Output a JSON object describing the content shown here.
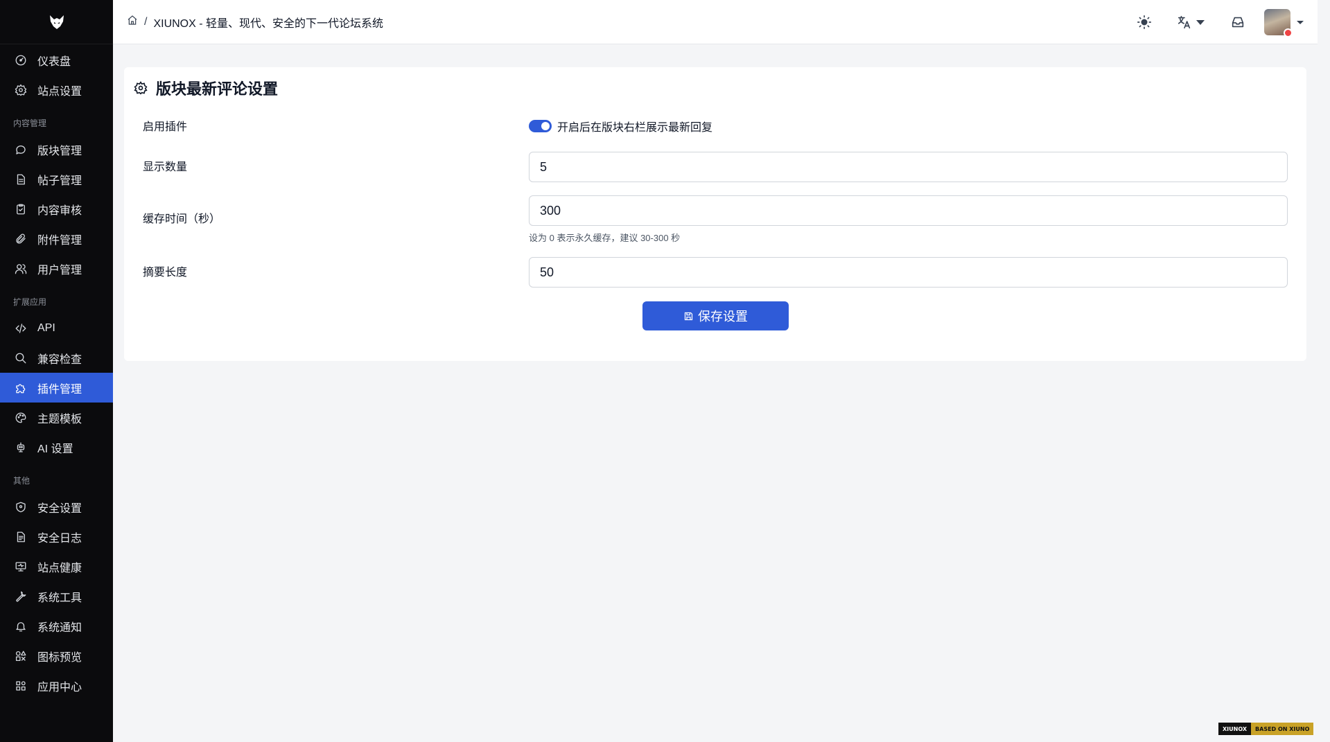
{
  "sidebar": {
    "logo_icon": "wolf-head-logo",
    "items_top": [
      {
        "label": "仪表盘",
        "icon": "dashboard-icon"
      },
      {
        "label": "站点设置",
        "icon": "gear-icon"
      }
    ],
    "section_content": "内容管理",
    "items_content": [
      {
        "label": "版块管理",
        "icon": "chat-bubble-icon"
      },
      {
        "label": "帖子管理",
        "icon": "document-icon"
      },
      {
        "label": "内容审核",
        "icon": "clipboard-check-icon"
      },
      {
        "label": "附件管理",
        "icon": "paperclip-icon"
      },
      {
        "label": "用户管理",
        "icon": "users-icon"
      }
    ],
    "section_apps": "扩展应用",
    "items_apps": [
      {
        "label": "API",
        "icon": "code-icon"
      },
      {
        "label": "兼容检查",
        "icon": "search-icon"
      },
      {
        "label": "插件管理",
        "icon": "puzzle-icon",
        "active": true
      },
      {
        "label": "主题模板",
        "icon": "palette-icon"
      },
      {
        "label": "AI 设置",
        "icon": "robot-icon"
      }
    ],
    "section_other": "其他",
    "items_other": [
      {
        "label": "安全设置",
        "icon": "shield-icon"
      },
      {
        "label": "安全日志",
        "icon": "log-icon"
      },
      {
        "label": "站点健康",
        "icon": "monitor-icon"
      },
      {
        "label": "系统工具",
        "icon": "wrench-icon"
      },
      {
        "label": "系统通知",
        "icon": "bell-icon"
      },
      {
        "label": "图标预览",
        "icon": "shapes-icon"
      },
      {
        "label": "应用中心",
        "icon": "grid-icon"
      }
    ]
  },
  "header": {
    "breadcrumb_sep": "/",
    "site_title": "XIUNOX - 轻量、现代、安全的下一代论坛系统",
    "icons": [
      "home-icon",
      "sun-icon",
      "translate-icon",
      "inbox-icon",
      "avatar"
    ]
  },
  "settings": {
    "title": "版块最新评论设置",
    "enable_label": "启用插件",
    "enable_text": "开启后在版块右栏展示最新回复",
    "enable_on": true,
    "count_label": "显示数量",
    "count_value": "5",
    "cache_label": "缓存时间（秒）",
    "cache_value": "300",
    "cache_hint": "设为 0 表示永久缓存，建议 30-300 秒",
    "excerpt_label": "摘要长度",
    "excerpt_value": "50",
    "save_label": "保存设置"
  },
  "footer": {
    "badge_left": "XIUNOX",
    "badge_right": "BASED ON XIUNO"
  },
  "colors": {
    "accent": "#2f5bd8",
    "sidebar_bg": "#0b0b0d",
    "page_bg": "#f4f5f7"
  }
}
